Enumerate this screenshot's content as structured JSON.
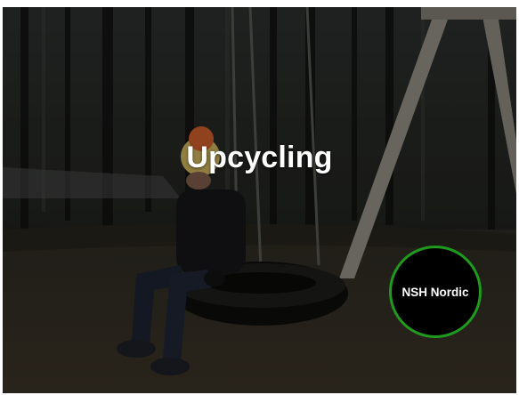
{
  "slide": {
    "title": "Upcycling",
    "badge_text": "NSH Nordic",
    "badge_border_color": "#1f9a1f"
  },
  "image": {
    "alt": "Child sitting on a tire swing in a forest",
    "icon": "photo-background"
  }
}
